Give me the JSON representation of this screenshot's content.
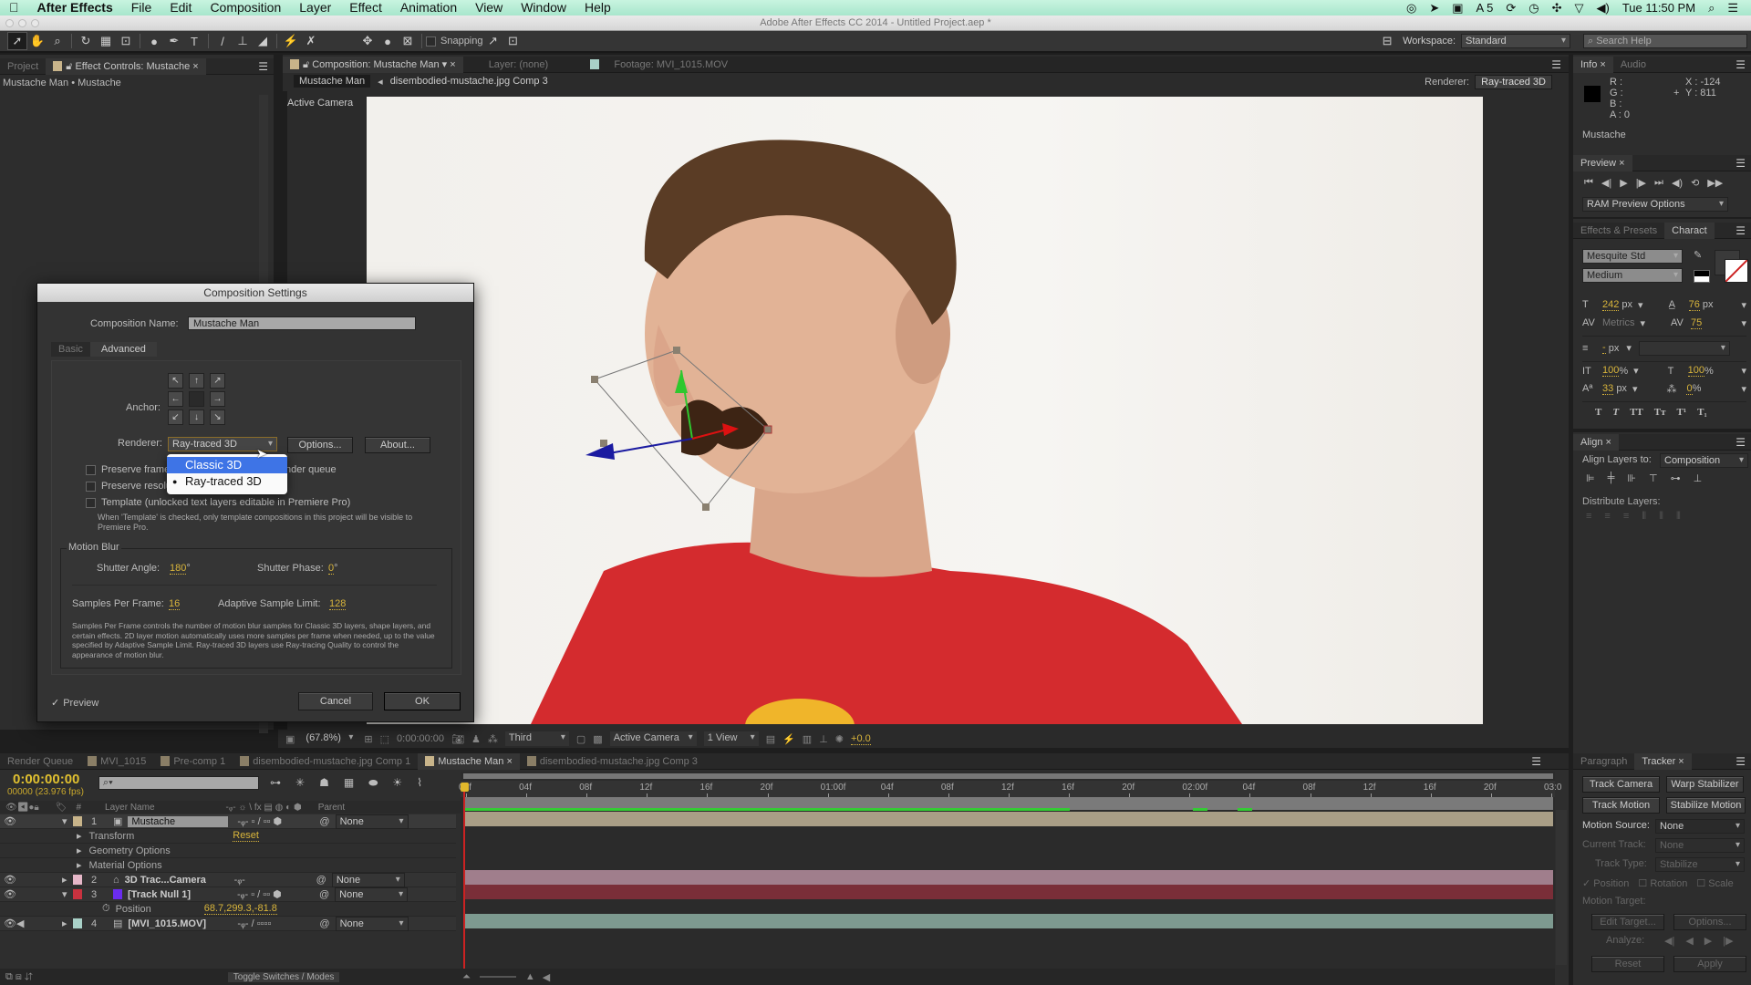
{
  "menubar": {
    "app": "After Effects",
    "items": [
      "File",
      "Edit",
      "Composition",
      "Layer",
      "Effect",
      "Animation",
      "View",
      "Window",
      "Help"
    ],
    "status_extra": "5",
    "clock": "Tue 11:50 PM"
  },
  "window_title": "Adobe After Effects CC 2014 - Untitled Project.aep *",
  "toolbar": {
    "snapping_label": "Snapping",
    "workspace_label": "Workspace:",
    "workspace_value": "Standard",
    "search_placeholder": "Search Help"
  },
  "left_panel": {
    "tab_project": "Project",
    "tab_effect_controls": "Effect Controls: Mustache",
    "breadcrumb": "Mustache Man • Mustache"
  },
  "comp_panel": {
    "tab_composition": "Composition: Mustache Man",
    "tab_layer": "Layer: (none)",
    "tab_footage": "Footage: MVI_1015.MOV",
    "nav_current": "Mustache Man",
    "nav_next": "disembodied-mustache.jpg Comp 3",
    "renderer_label": "Renderer:",
    "renderer_value": "Ray-traced 3D",
    "view_label": "Active Camera",
    "footer": {
      "zoom": "(67.8%)",
      "timecode": "0:00:00:00",
      "resolution": "Third",
      "camera": "Active Camera",
      "views": "1 View",
      "exposure": "+0.0"
    }
  },
  "dialog": {
    "title": "Composition Settings",
    "name_label": "Composition Name:",
    "name_value": "Mustache Man",
    "tab_basic": "Basic",
    "tab_advanced": "Advanced",
    "anchor_label": "Anchor:",
    "renderer_label": "Renderer:",
    "renderer_value": "Ray-traced 3D",
    "options_button": "Options...",
    "about_button": "About...",
    "dropdown_options": [
      "Classic 3D",
      "Ray-traced 3D"
    ],
    "preserve_frame_rate": "Preserve frame rate when nested or in render queue",
    "preserve_frame_visible_a": "Preserve frame",
    "preserve_frame_visible_b": "nder queue",
    "preserve_resolution": "Preserve resolu",
    "template_label": "Template (unlocked text layers editable in Premiere Pro)",
    "template_note": "When 'Template' is checked, only template compositions in this project will be visible to Premiere Pro.",
    "motion_blur_title": "Motion Blur",
    "shutter_angle_label": "Shutter Angle:",
    "shutter_angle_value": "180",
    "shutter_phase_label": "Shutter Phase:",
    "shutter_phase_value": "0",
    "degree": "°",
    "samples_label": "Samples Per Frame:",
    "samples_value": "16",
    "adaptive_label": "Adaptive Sample Limit:",
    "adaptive_value": "128",
    "help_text": "Samples Per Frame controls the number of motion blur samples for Classic 3D layers, shape layers, and certain effects. 2D layer motion automatically uses more samples per frame when needed, up to the value specified by Adaptive Sample Limit. Ray-traced 3D layers use Ray-tracing Quality to control the appearance of motion blur.",
    "preview_label": "Preview",
    "cancel_button": "Cancel",
    "ok_button": "OK"
  },
  "info_panel": {
    "tab_info": "Info",
    "tab_audio": "Audio",
    "r": "R :",
    "g": "G :",
    "b": "B :",
    "a": "A : 0",
    "x": "X : -124",
    "y": "Y : 811",
    "layer_name": "Mustache"
  },
  "preview_panel": {
    "tab": "Preview",
    "ram_options": "RAM Preview Options"
  },
  "character_panel": {
    "tab_effects": "Effects & Presets",
    "tab_character": "Charact",
    "font": "Mesquite Std",
    "style": "Medium",
    "size": "242",
    "size_unit": "px",
    "leading": "76",
    "leading_unit": "px",
    "kerning": "Metrics",
    "tracking": "75",
    "stroke": "-",
    "stroke_unit": "px",
    "vscale": "100",
    "hscale": "100",
    "pct": "%",
    "baseline": "33",
    "baseline_unit": "px",
    "tsume": "0"
  },
  "align_panel": {
    "tab": "Align",
    "align_to_label": "Align Layers to:",
    "align_to_value": "Composition",
    "distribute_label": "Distribute Layers:"
  },
  "tracker_panel": {
    "tab_paragraph": "Paragraph",
    "tab_tracker": "Tracker",
    "track_camera": "Track Camera",
    "warp_stabilizer": "Warp Stabilizer",
    "track_motion": "Track Motion",
    "stabilize_motion": "Stabilize Motion",
    "motion_source_label": "Motion Source:",
    "motion_source_value": "None",
    "current_track_label": "Current Track:",
    "current_track_value": "None",
    "track_type_label": "Track Type:",
    "track_type_value": "Stabilize",
    "position": "Position",
    "rotation": "Rotation",
    "scale": "Scale",
    "motion_target_label": "Motion Target:",
    "edit_target": "Edit Target...",
    "options": "Options...",
    "analyze_label": "Analyze:",
    "reset": "Reset",
    "apply": "Apply"
  },
  "timeline": {
    "tabs": [
      "Render Queue",
      "MVI_1015",
      "Pre-comp 1",
      "disembodied-mustache.jpg Comp 1",
      "Mustache Man",
      "disembodied-mustache.jpg Comp 3"
    ],
    "timecode": "0:00:00:00",
    "frame_info": "00000 (23.976 fps)",
    "col_layer_name": "Layer Name",
    "col_parent": "Parent",
    "ruler": [
      "00f",
      "04f",
      "08f",
      "12f",
      "16f",
      "20f",
      "01:00f",
      "04f",
      "08f",
      "12f",
      "16f",
      "20f",
      "02:00f",
      "04f",
      "08f",
      "12f",
      "16f",
      "20f",
      "03:0"
    ],
    "layers": [
      {
        "num": "1",
        "name": "Mustache",
        "parent": "None",
        "color": "#c8b48a"
      },
      {
        "num": "2",
        "name": "3D Trac...Camera",
        "parent": "None",
        "color": "#e6b7c8"
      },
      {
        "num": "3",
        "name": "[Track Null 1]",
        "parent": "None",
        "color": "#c9323f"
      },
      {
        "num": "4",
        "name": "[MVI_1015.MOV]",
        "parent": "None",
        "color": "#a9d1c8"
      }
    ],
    "sub_transform": "Transform",
    "sub_transform_value": "Reset",
    "sub_geometry": "Geometry Options",
    "sub_material": "Material Options",
    "position_label": "Position",
    "position_value": "68.7,299.3,-81.8",
    "toggle_label": "Toggle Switches / Modes"
  }
}
